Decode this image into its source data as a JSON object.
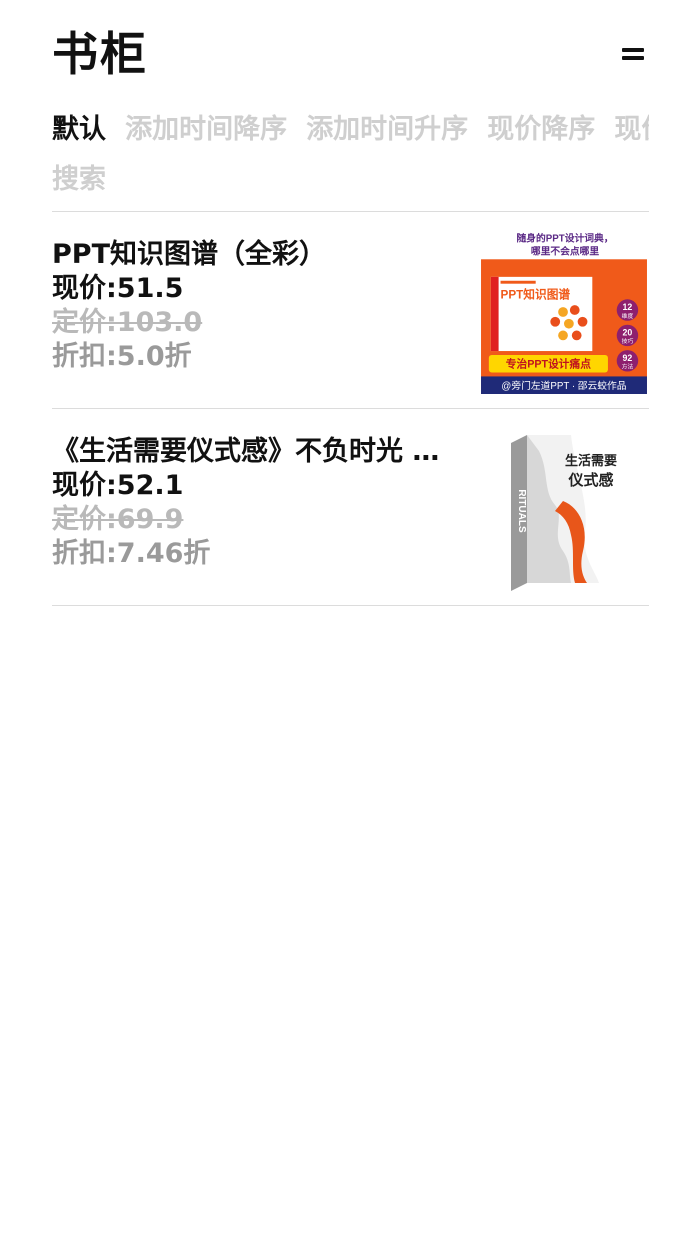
{
  "header": {
    "title": "书柜"
  },
  "sort": {
    "options": [
      "默认",
      "添加时间降序",
      "添加时间升序",
      "现价降序",
      "现价升序"
    ]
  },
  "search": {
    "label": "搜索"
  },
  "books": [
    {
      "title": "PPT知识图谱（全彩）",
      "current_price": "现价:51.5",
      "original_price": "定价:103.0",
      "discount": "折扣:5.0折",
      "cover": {
        "tagline1": "随身的PPT设计词典，",
        "tagline2": "哪里不会点哪里",
        "book_title": "PPT知识图谱",
        "badge1": "12",
        "badge1_text": "维度",
        "badge2": "20",
        "badge2_text": "技巧",
        "badge3": "92",
        "badge3_text": "方法",
        "banner": "专治PPT设计痛点",
        "author": "@旁门左道PPT · 邵云蛟作品"
      }
    },
    {
      "title": "《生活需要仪式感》不负时光 不负自己",
      "current_price": "现价:52.1",
      "original_price": "定价:69.9",
      "discount": "折扣:7.46折",
      "cover": {
        "title_line1": "生活需要",
        "title_line2": "仪式感",
        "spine_text": "RITUALS"
      }
    }
  ]
}
